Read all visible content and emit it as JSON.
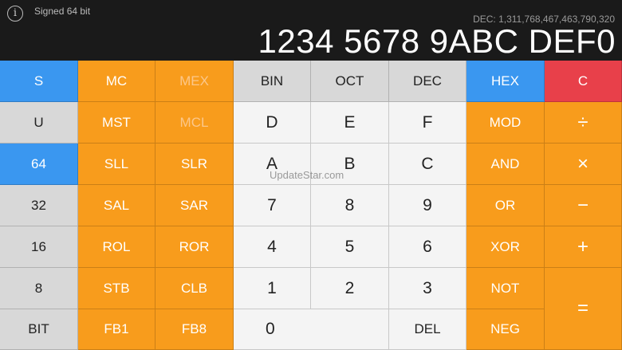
{
  "header": {
    "mode_label": "Signed 64 bit",
    "dec_readout": "DEC: 1,311,768,467,463,790,320",
    "main_value": "1234 5678 9ABC DEF0",
    "info_icon": "ⓘ",
    "info_glyph": "i"
  },
  "keys": {
    "s": "S",
    "mc": "MC",
    "mex": "MEX",
    "bin": "BIN",
    "oct": "OCT",
    "dec": "DEC",
    "hex": "HEX",
    "c": "C",
    "u": "U",
    "mst": "MST",
    "mcl": "MCL",
    "d": "D",
    "e": "E",
    "f": "F",
    "mod": "MOD",
    "div": "÷",
    "b64": "64",
    "sll": "SLL",
    "slr": "SLR",
    "a": "A",
    "b": "B",
    "c_hex": "C",
    "and": "AND",
    "mul": "×",
    "b32": "32",
    "sal": "SAL",
    "sar": "SAR",
    "n7": "7",
    "n8": "8",
    "n9": "9",
    "or": "OR",
    "minus": "−",
    "b16": "16",
    "rol": "ROL",
    "ror": "ROR",
    "n4": "4",
    "n5": "5",
    "n6": "6",
    "xor": "XOR",
    "plus": "+",
    "b8": "8",
    "stb": "STB",
    "clb": "CLB",
    "n1": "1",
    "n2": "2",
    "n3": "3",
    "not": "NOT",
    "equals": "=",
    "bit": "BIT",
    "fb1": "FB1",
    "fb8": "FB8",
    "n0": "0",
    "del": "DEL",
    "neg": "NEG"
  },
  "watermark": "UpdateStar.com",
  "colors": {
    "blue": "#3a97f0",
    "orange": "#f89c1c",
    "red": "#e8404a",
    "gray": "#d8d8d8",
    "light": "#f4f4f4",
    "display_bg": "#1a1a1a"
  }
}
